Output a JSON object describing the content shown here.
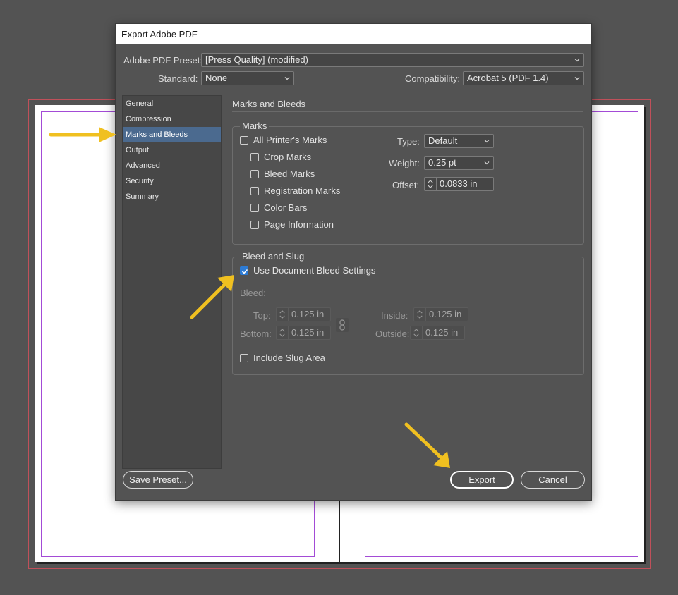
{
  "dialog": {
    "title": "Export Adobe PDF",
    "preset_label": "Adobe PDF Preset:",
    "preset_value": "[Press Quality] (modified)",
    "standard_label": "Standard:",
    "standard_value": "None",
    "compat_label": "Compatibility:",
    "compat_value": "Acrobat 5 (PDF 1.4)"
  },
  "nav": {
    "items": [
      "General",
      "Compression",
      "Marks and Bleeds",
      "Output",
      "Advanced",
      "Security",
      "Summary"
    ],
    "selected": "Marks and Bleeds"
  },
  "panel": {
    "title": "Marks and Bleeds",
    "marks": {
      "group_title": "Marks",
      "all_printers_marks": "All Printer's Marks",
      "crop_marks": "Crop Marks",
      "bleed_marks": "Bleed Marks",
      "registration_marks": "Registration Marks",
      "color_bars": "Color Bars",
      "page_information": "Page Information",
      "type_label": "Type:",
      "type_value": "Default",
      "weight_label": "Weight:",
      "weight_value": "0.25 pt",
      "offset_label": "Offset:",
      "offset_value": "0.0833 in"
    },
    "bleed": {
      "group_title": "Bleed and Slug",
      "use_document_bleed": "Use Document Bleed Settings",
      "use_document_bleed_checked": true,
      "bleed_label": "Bleed:",
      "top_label": "Top:",
      "top_value": "0.125 in",
      "bottom_label": "Bottom:",
      "bottom_value": "0.125 in",
      "inside_label": "Inside:",
      "inside_value": "0.125 in",
      "outside_label": "Outside:",
      "outside_value": "0.125 in",
      "include_slug": "Include Slug Area"
    }
  },
  "buttons": {
    "save_preset": "Save Preset...",
    "export": "Export",
    "cancel": "Cancel"
  },
  "colors": {
    "annotation_arrow": "#f0c020",
    "selection": "#4b6a8f",
    "checkbox_checked": "#2d7bd4"
  }
}
